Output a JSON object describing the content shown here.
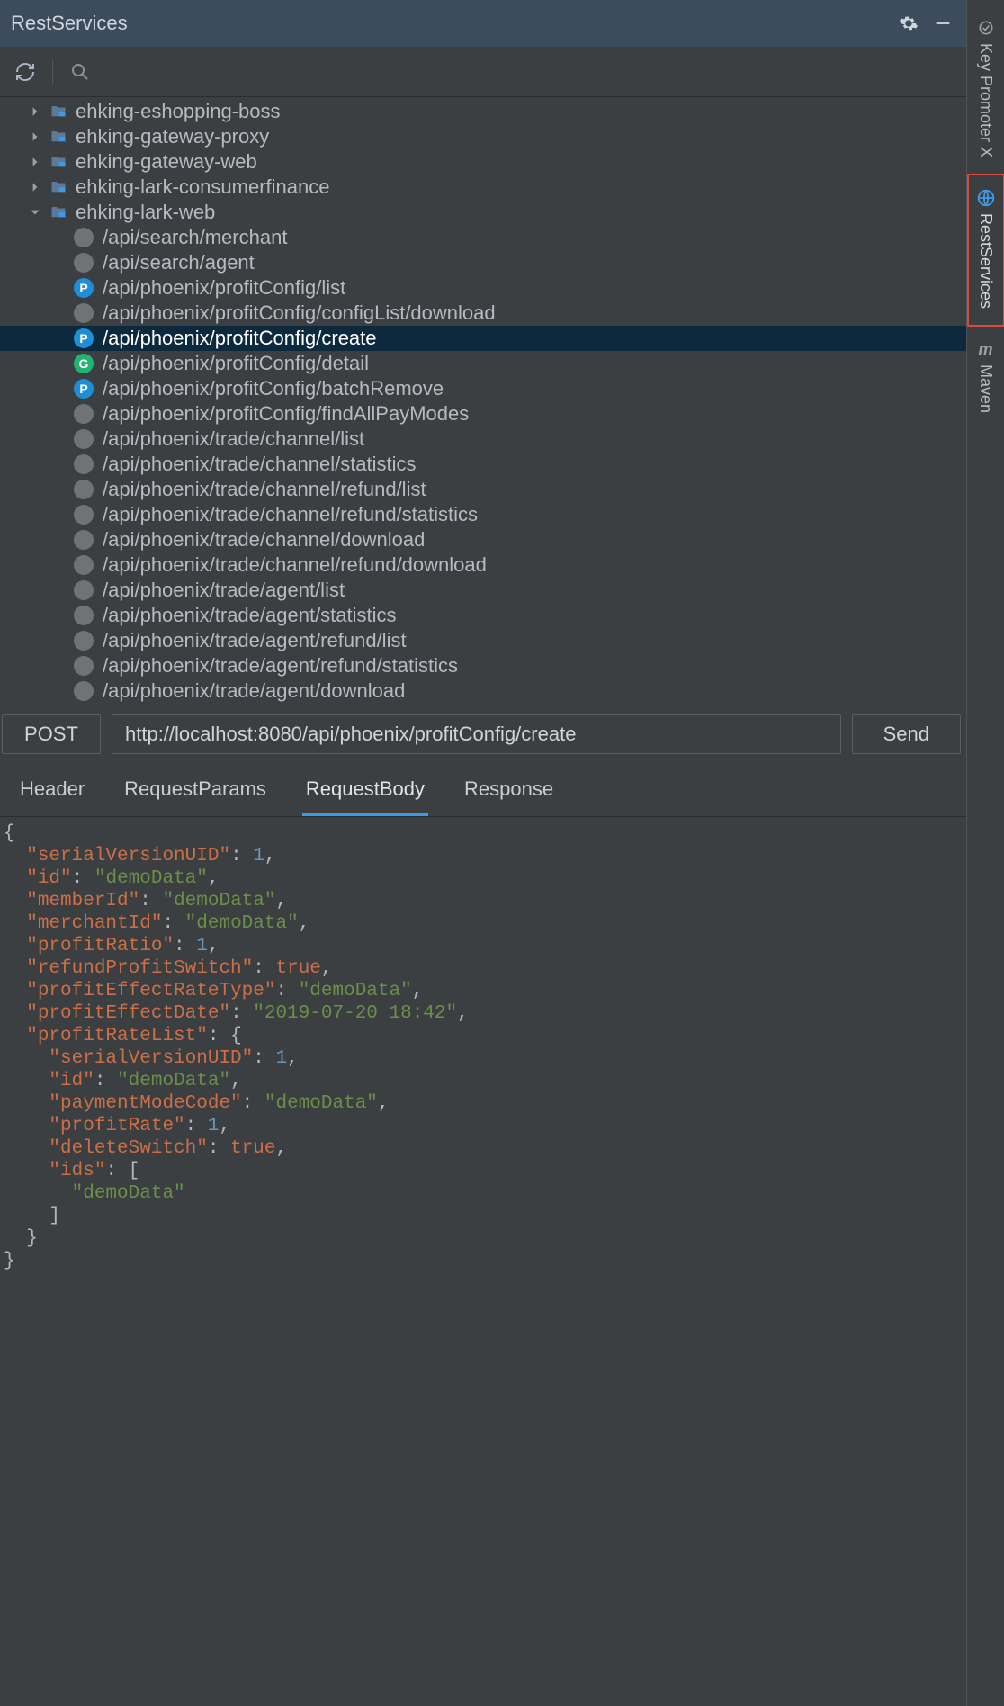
{
  "window": {
    "title": "RestServices"
  },
  "tree": {
    "folders": [
      {
        "name": "ehking-eshopping-boss",
        "expanded": false,
        "truncated": true
      },
      {
        "name": "ehking-gateway-proxy",
        "expanded": false
      },
      {
        "name": "ehking-gateway-web",
        "expanded": false
      },
      {
        "name": "ehking-lark-consumerfinance",
        "expanded": false
      },
      {
        "name": "ehking-lark-web",
        "expanded": true
      }
    ],
    "endpoints": [
      {
        "method": "",
        "path": "/api/search/merchant"
      },
      {
        "method": "",
        "path": "/api/search/agent"
      },
      {
        "method": "P",
        "path": "/api/phoenix/profitConfig/list"
      },
      {
        "method": "",
        "path": "/api/phoenix/profitConfig/configList/download"
      },
      {
        "method": "P",
        "path": "/api/phoenix/profitConfig/create",
        "selected": true
      },
      {
        "method": "G",
        "path": "/api/phoenix/profitConfig/detail"
      },
      {
        "method": "P",
        "path": "/api/phoenix/profitConfig/batchRemove"
      },
      {
        "method": "",
        "path": "/api/phoenix/profitConfig/findAllPayModes"
      },
      {
        "method": "",
        "path": "/api/phoenix/trade/channel/list"
      },
      {
        "method": "",
        "path": "/api/phoenix/trade/channel/statistics"
      },
      {
        "method": "",
        "path": "/api/phoenix/trade/channel/refund/list"
      },
      {
        "method": "",
        "path": "/api/phoenix/trade/channel/refund/statistics"
      },
      {
        "method": "",
        "path": "/api/phoenix/trade/channel/download"
      },
      {
        "method": "",
        "path": "/api/phoenix/trade/channel/refund/download"
      },
      {
        "method": "",
        "path": "/api/phoenix/trade/agent/list"
      },
      {
        "method": "",
        "path": "/api/phoenix/trade/agent/statistics"
      },
      {
        "method": "",
        "path": "/api/phoenix/trade/agent/refund/list"
      },
      {
        "method": "",
        "path": "/api/phoenix/trade/agent/refund/statistics"
      },
      {
        "method": "",
        "path": "/api/phoenix/trade/agent/download"
      }
    ]
  },
  "request": {
    "method": "POST",
    "url": "http://localhost:8080/api/phoenix/profitConfig/create",
    "send_label": "Send"
  },
  "tabs": {
    "items": [
      "Header",
      "RequestParams",
      "RequestBody",
      "Response"
    ],
    "active_index": 2
  },
  "request_body": {
    "serialVersionUID": 1,
    "id": "demoData",
    "memberId": "demoData",
    "merchantId": "demoData",
    "profitRatio": 1,
    "refundProfitSwitch": true,
    "profitEffectRateType": "demoData",
    "profitEffectDate": "2019-07-20 18:42",
    "profitRateList": {
      "serialVersionUID": 1,
      "id": "demoData",
      "paymentModeCode": "demoData",
      "profitRate": 1,
      "deleteSwitch": true,
      "ids": [
        "demoData"
      ]
    }
  },
  "rail": {
    "items": [
      {
        "id": "key-promoter",
        "label": "Key Promoter X",
        "icon": "kpx"
      },
      {
        "id": "rest-services",
        "label": "RestServices",
        "icon": "rest",
        "active": true
      },
      {
        "id": "maven",
        "label": "Maven",
        "icon": "maven"
      }
    ]
  }
}
